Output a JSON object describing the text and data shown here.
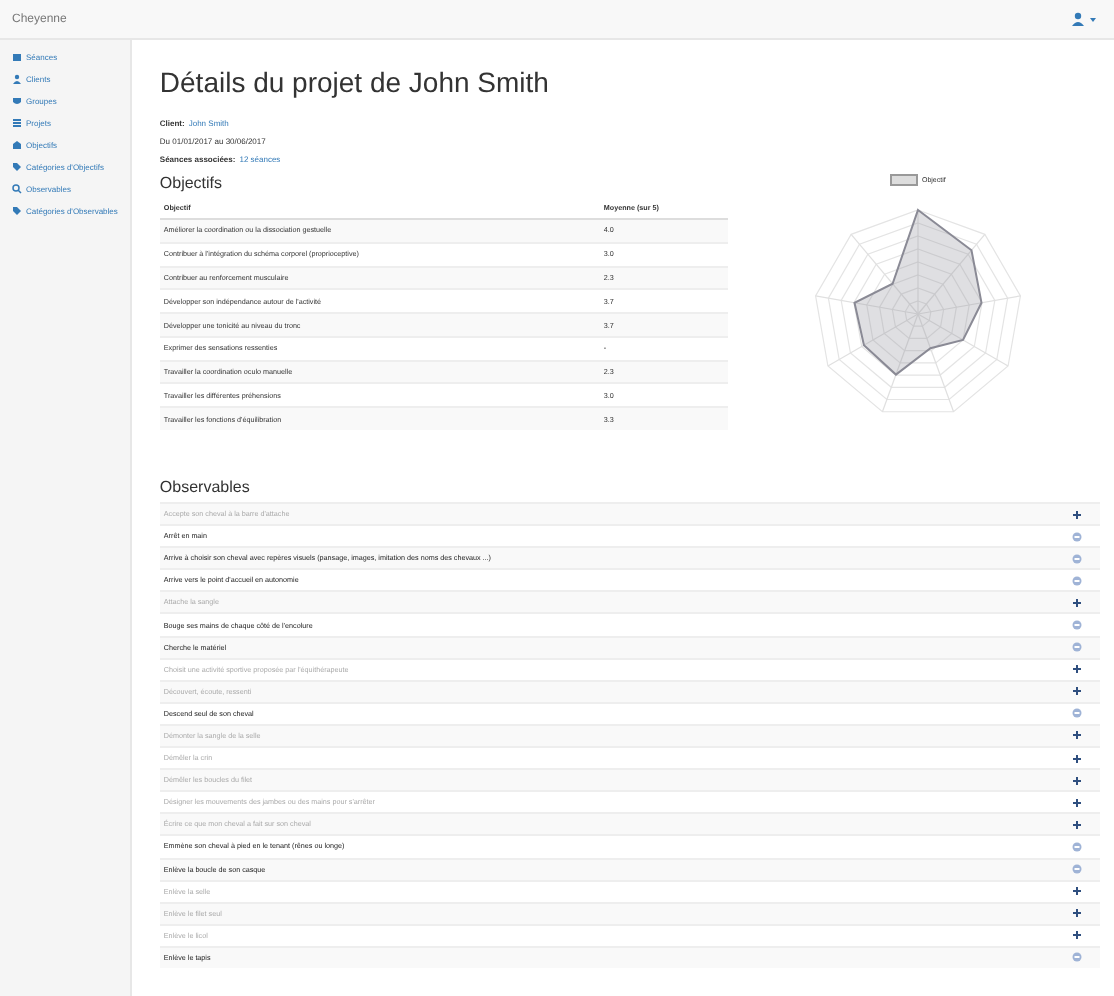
{
  "navbar": {
    "brand": "Cheyenne"
  },
  "sidebar": {
    "items": [
      {
        "label": "Séances"
      },
      {
        "label": "Clients"
      },
      {
        "label": "Groupes"
      },
      {
        "label": "Projets"
      },
      {
        "label": "Objectifs"
      },
      {
        "label": "Catégories d'Objectifs"
      },
      {
        "label": "Observables"
      },
      {
        "label": "Catégories d'Observables"
      }
    ]
  },
  "page": {
    "title": "Détails du projet de John Smith",
    "client_label": "Client:",
    "client": "John Smith",
    "period": "Du 01/01/2017 au 30/06/2017",
    "sessions_label": "Séances associées:",
    "sessions": "12 séances"
  },
  "objectives": {
    "heading": "Objectifs",
    "columns": [
      "Objectif",
      "Moyenne (sur 5)"
    ],
    "rows": [
      {
        "name": "Améliorer la coordination ou la dissociation gestuelle",
        "score": "4.0"
      },
      {
        "name": "Contribuer à l'intégration du schéma corporel (proprioceptive)",
        "score": "3.0"
      },
      {
        "name": "Contribuer au renforcement musculaire",
        "score": "2.3"
      },
      {
        "name": "Développer son indépendance autour de l'activité",
        "score": "3.7"
      },
      {
        "name": "Développer une tonicité au niveau du tronc",
        "score": "3.7"
      },
      {
        "name": "Exprimer des sensations ressenties",
        "score": "-"
      },
      {
        "name": "Travailler la coordination oculo manuelle",
        "score": "2.3"
      },
      {
        "name": "Travailler les différentes préhensions",
        "score": "3.0"
      },
      {
        "name": "Travailler les fonctions d'équilibration",
        "score": "3.3"
      }
    ],
    "chart": {
      "legend": "Objectif"
    }
  },
  "observables": {
    "heading": "Observables",
    "items": [
      {
        "label": "Accepte son cheval à la barre d'attache",
        "active": false
      },
      {
        "label": "Arrêt en main",
        "active": true
      },
      {
        "label": "Arrive à choisir son cheval avec repères visuels (pansage, images, imitation des noms des chevaux ...)",
        "active": true
      },
      {
        "label": "Arrive vers le point d'accueil en autonomie",
        "active": true
      },
      {
        "label": "Attache la sangle",
        "active": false
      },
      {
        "label": "Bouge ses mains de chaque côté de l'encolure",
        "active": true
      },
      {
        "label": "Cherche le matériel",
        "active": true
      },
      {
        "label": "Choisit une activité sportive proposée par l'équithérapeute",
        "active": false
      },
      {
        "label": "Découvert, écoute, ressenti",
        "active": false
      },
      {
        "label": "Descend seul de son cheval",
        "active": true
      },
      {
        "label": "Démonter la sangle de la selle",
        "active": false
      },
      {
        "label": "Démêler la crin",
        "active": false
      },
      {
        "label": "Démêler les boucles du filet",
        "active": false
      },
      {
        "label": "Désigner les mouvements des jambes ou des mains pour s'arrêter",
        "active": false
      },
      {
        "label": "Écrire ce que mon cheval a fait sur son cheval",
        "active": false
      },
      {
        "label": "Emmène son cheval à pied en le tenant (rênes ou longe)",
        "active": true
      },
      {
        "label": "Enlève la boucle de son casque",
        "active": true
      },
      {
        "label": "Enlève la selle",
        "active": false
      },
      {
        "label": "Enlève le filet seul",
        "active": false
      },
      {
        "label": "Enlève le licol",
        "active": false
      },
      {
        "label": "Enlève le tapis",
        "active": true
      }
    ]
  }
}
